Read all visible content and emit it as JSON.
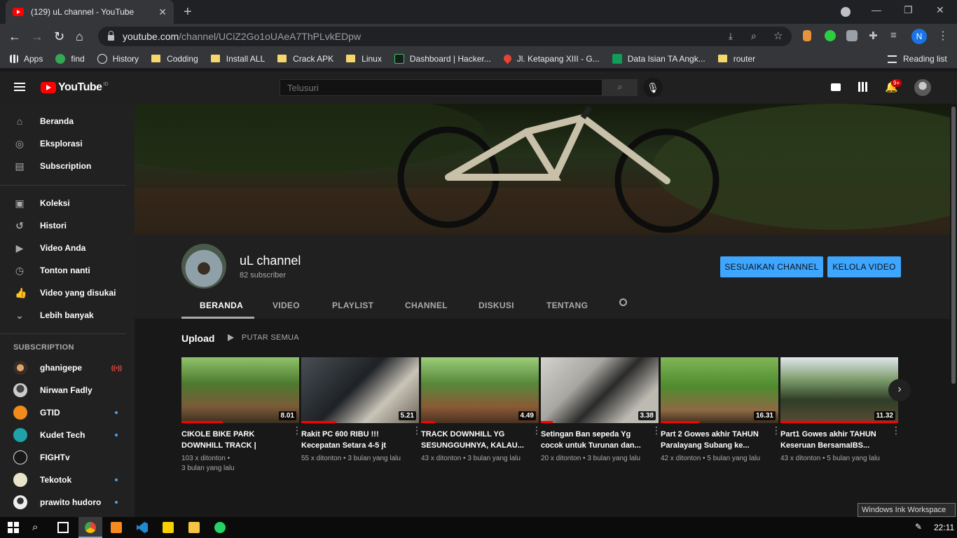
{
  "browser": {
    "tab_title": "(129) uL channel - YouTube",
    "url_domain": "youtube.com",
    "url_path": "/channel/UCiZ2Go1oUAeA7ThPLvkEDpw",
    "profile_initial": "N",
    "bookmarks": [
      "Apps",
      "find",
      "History",
      "Codding",
      "Install ALL",
      "Crack APK",
      "Linux",
      "Dashboard | Hacker...",
      "Jl. Ketapang XIII - G...",
      "Data Isian TA Angk...",
      "router"
    ],
    "reading_list": "Reading list"
  },
  "youtube": {
    "logo_text": "YouTube",
    "logo_sup": "ID",
    "search_placeholder": "Telusuri",
    "notif_badge": "9+",
    "sidebar": {
      "primary": [
        "Beranda",
        "Eksplorasi",
        "Subscription"
      ],
      "library": [
        "Koleksi",
        "Histori",
        "Video Anda",
        "Tonton nanti",
        "Video yang disukai",
        "Lebih banyak"
      ],
      "subs_header": "SUBSCRIPTION",
      "subscriptions": [
        "ghanigepe",
        "Nirwan Fadly",
        "GTID",
        "Kudet Tech",
        "FIGHTv",
        "Tekotok",
        "prawito hudoro"
      ]
    },
    "channel": {
      "name": "uL channel",
      "subscribers": "82 subscriber",
      "customize_btn": "SESUAIKAN CHANNEL",
      "manage_btn": "KELOLA VIDEO",
      "tabs": [
        "BERANDA",
        "VIDEO",
        "PLAYLIST",
        "CHANNEL",
        "DISKUSI",
        "TENTANG"
      ]
    },
    "section": {
      "title": "Upload",
      "play_all": "PUTAR SEMUA"
    },
    "videos": [
      {
        "title": "CIKOLE BIKE PARK DOWNHILL TRACK | Setela...",
        "duration": "8.01",
        "views": "103 x ditonton",
        "age": "3 bulan yang lalu",
        "progress": 0.35
      },
      {
        "title": "Rakit PC 600 RIBU !!! Kecepatan Setara 4-5 jt",
        "duration": "5.21",
        "views": "55 x ditonton",
        "age": "3 bulan yang lalu",
        "progress": 0.3
      },
      {
        "title": "TRACK DOWNHILL YG SESUNGGUHNYA, KALAU...",
        "duration": "4.49",
        "views": "43 x ditonton",
        "age": "3 bulan yang lalu",
        "progress": 0.12
      },
      {
        "title": "Setingan Ban sepeda Yg cocok untuk Turunan dan...",
        "duration": "3.38",
        "views": "20 x ditonton",
        "age": "3 bulan yang lalu",
        "progress": 0.1
      },
      {
        "title": "Part 2 Gowes akhir TAHUN Paralayang Subang ke...",
        "duration": "16.31",
        "views": "42 x ditonton",
        "age": "5 bulan yang lalu",
        "progress": 0.33
      },
      {
        "title": "Part1 Gowes akhir TAHUN Keseruan BersamaIBS...",
        "duration": "11.32",
        "views": "43 x ditonton",
        "age": "5 bulan yang lalu",
        "progress": 1.0
      }
    ]
  },
  "os": {
    "time": "22:11",
    "ink_tooltip": "Windows Ink Workspace"
  }
}
